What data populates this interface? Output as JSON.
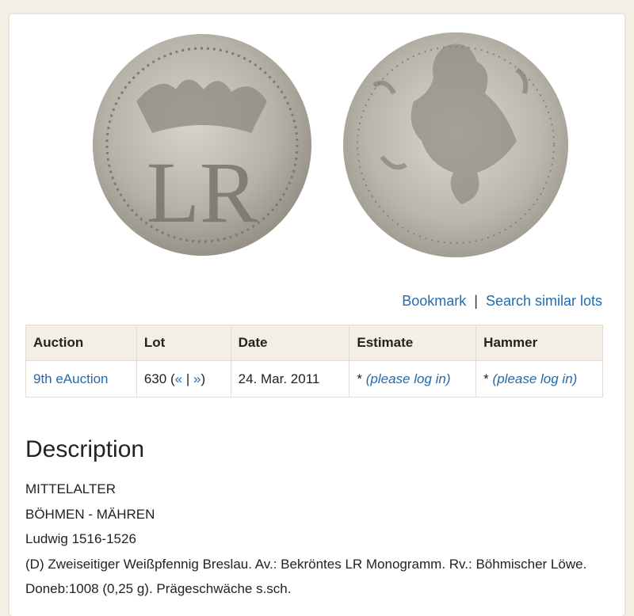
{
  "actions": {
    "bookmark": "Bookmark",
    "separator": "|",
    "search_similar": "Search similar lots"
  },
  "table": {
    "headers": {
      "auction": "Auction",
      "lot": "Lot",
      "date": "Date",
      "estimate": "Estimate",
      "hammer": "Hammer"
    },
    "row": {
      "auction": "9th eAuction",
      "lot_number": "630",
      "lot_open": "(",
      "lot_prev": "«",
      "lot_sep": "|",
      "lot_next": "»",
      "lot_close": ")",
      "date": "24. Mar. 2011",
      "estimate_star": "*",
      "estimate_login": "(please log in)",
      "hammer_star": "*",
      "hammer_login": "(please log in)"
    }
  },
  "description": {
    "title": "Description",
    "lines": [
      "MITTELALTER",
      "BÖHMEN - MÄHREN",
      "Ludwig 1516-1526",
      "(D) Zweiseitiger Weißpfennig Breslau. Av.: Bekröntes LR Monogramm. Rv.: Böhmischer Löwe. Doneb:1008 (0,25 g). Prägeschwäche s.sch."
    ]
  },
  "coin": {
    "obverse_monogram": "LR"
  },
  "colors": {
    "link": "#1f6cb0",
    "header_bg": "#f3efe6",
    "coin_silver": "#b9b5ac"
  }
}
